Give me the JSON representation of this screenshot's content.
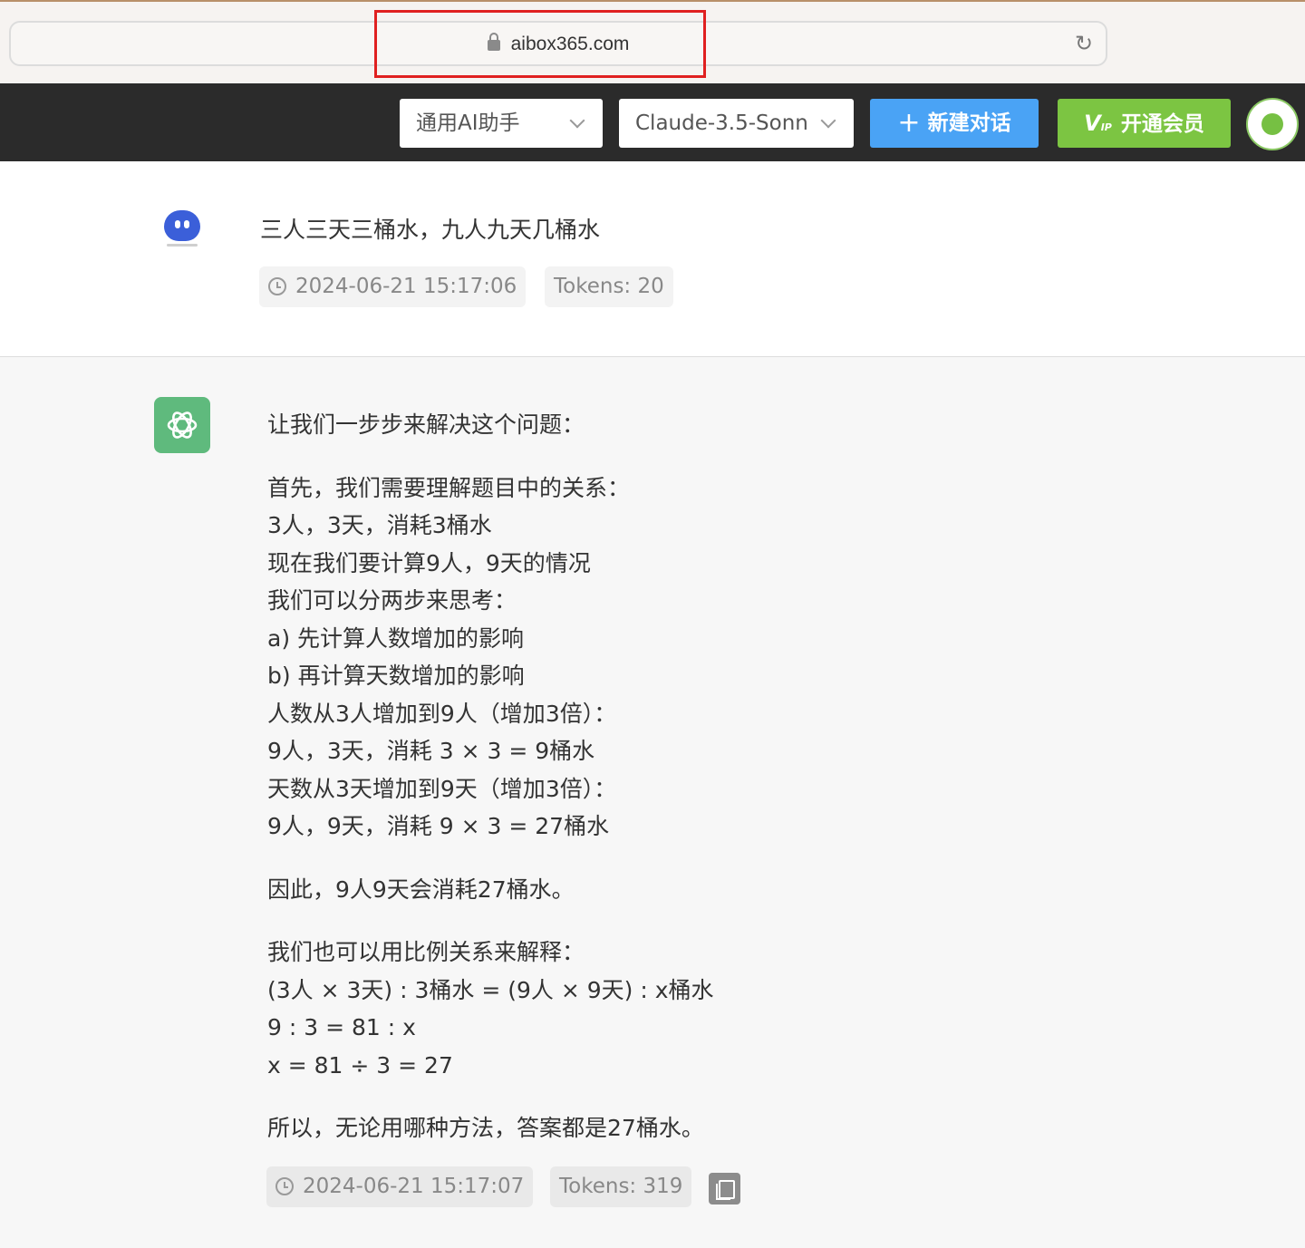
{
  "browser": {
    "url": "aibox365.com"
  },
  "header": {
    "assistant_select": "通用AI助手",
    "model_select": "Claude-3.5-Sonn",
    "new_chat_label": "新建对话",
    "new_chat_icon": "+",
    "vip_label": "开通会员",
    "vip_icon_text": "V",
    "vip_icon_sub": "IP"
  },
  "user_message": {
    "text": "三人三天三桶水，九人九天几桶水",
    "time": "2024-06-21 15:17:06",
    "tokens": "Tokens: 20"
  },
  "assistant_message": {
    "paragraphs": [
      [
        "让我们一步步来解决这个问题："
      ],
      [
        "首先，我们需要理解题目中的关系：",
        "3人，3天，消耗3桶水",
        "现在我们要计算9人，9天的情况",
        "我们可以分两步来思考：",
        "a) 先计算人数增加的影响",
        "b) 再计算天数增加的影响",
        "人数从3人增加到9人（增加3倍）：",
        "9人，3天，消耗 3 × 3 = 9桶水",
        "天数从3天增加到9天（增加3倍）：",
        "9人，9天，消耗 9 × 3 = 27桶水"
      ],
      [
        "因此，9人9天会消耗27桶水。"
      ],
      [
        "我们也可以用比例关系来解释：",
        "(3人 × 3天) : 3桶水 = (9人 × 9天) : x桶水",
        "9 : 3 = 81 : x",
        "x = 81 ÷ 3 = 27"
      ],
      [
        "所以，无论用哪种方法，答案都是27桶水。"
      ]
    ],
    "time": "2024-06-21 15:17:07",
    "tokens": "Tokens: 319"
  },
  "colors": {
    "new_button": "#4aa3f5",
    "vip_button": "#7cc542",
    "gpt_logo": "#5fba7d",
    "highlight_box": "#e02020"
  }
}
